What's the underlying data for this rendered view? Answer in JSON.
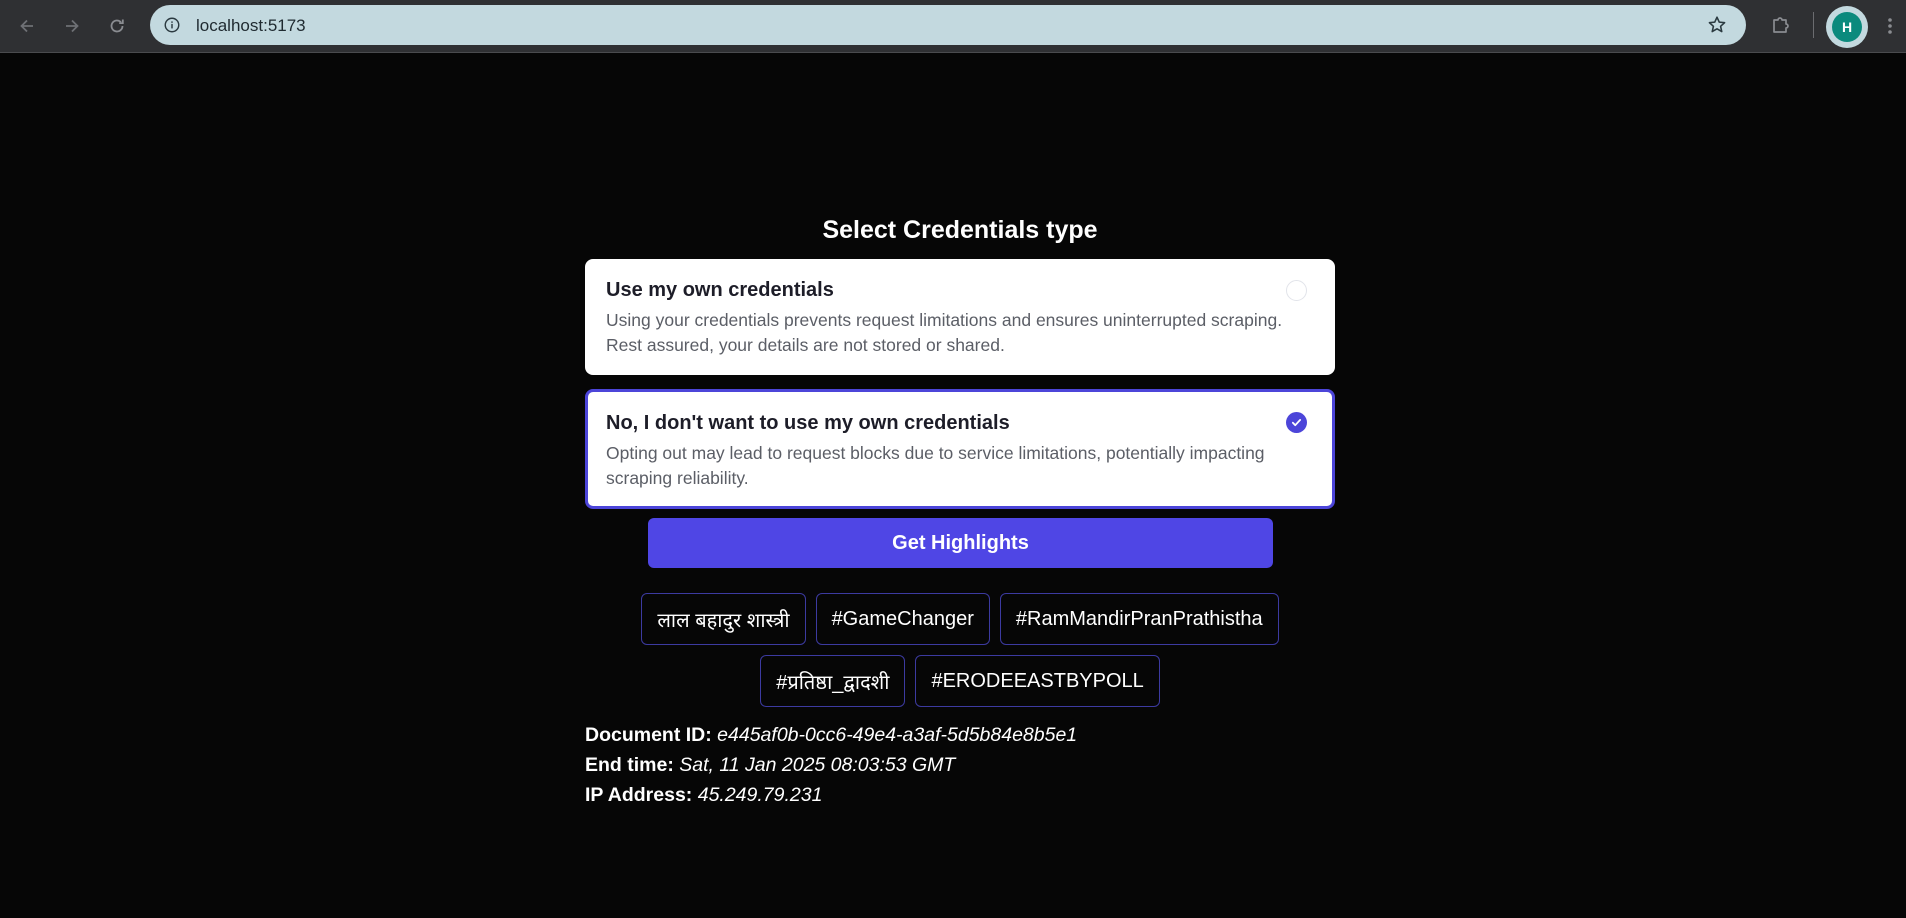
{
  "browser": {
    "url": "localhost:5173",
    "profile_initial": "H",
    "icons": {
      "back": "arrow-left-icon",
      "forward": "arrow-right-icon",
      "reload": "reload-icon",
      "site_info": "info-icon",
      "bookmark": "star-icon",
      "extensions": "puzzle-icon",
      "menu": "kebab-menu-icon"
    }
  },
  "page": {
    "title": "Select Credentials type",
    "options": [
      {
        "title": "Use my own credentials",
        "description": "Using your credentials prevents request limitations and ensures uninterrupted scraping. Rest assured, your details are not stored or shared.",
        "selected": false
      },
      {
        "title": "No, I don't want to use my own credentials",
        "description": "Opting out may lead to request blocks due to service limitations, potentially impacting scraping reliability.",
        "selected": true
      }
    ],
    "cta_label": "Get Highlights",
    "tags": [
      "लाल बहादुर शास्त्री",
      "#GameChanger",
      "#RamMandirPranPrathistha",
      "#प्रतिष्ठा_द्वादशी",
      "#ERODEEASTBYPOLL"
    ],
    "meta": {
      "document_id_label": "Document ID:",
      "document_id": "e445af0b-0cc6-49e4-a3af-5d5b84e8b5e1",
      "end_time_label": "End time:",
      "end_time": "Sat, 11 Jan 2025 08:03:53 GMT",
      "ip_label": "IP Address:",
      "ip": "45.249.79.231"
    }
  },
  "colors": {
    "background": "#060606",
    "accent": "#4f46e5",
    "tag_border": "#3c3aa0",
    "omnibox": "#c3d9df",
    "avatar": "#0b8a7d"
  }
}
